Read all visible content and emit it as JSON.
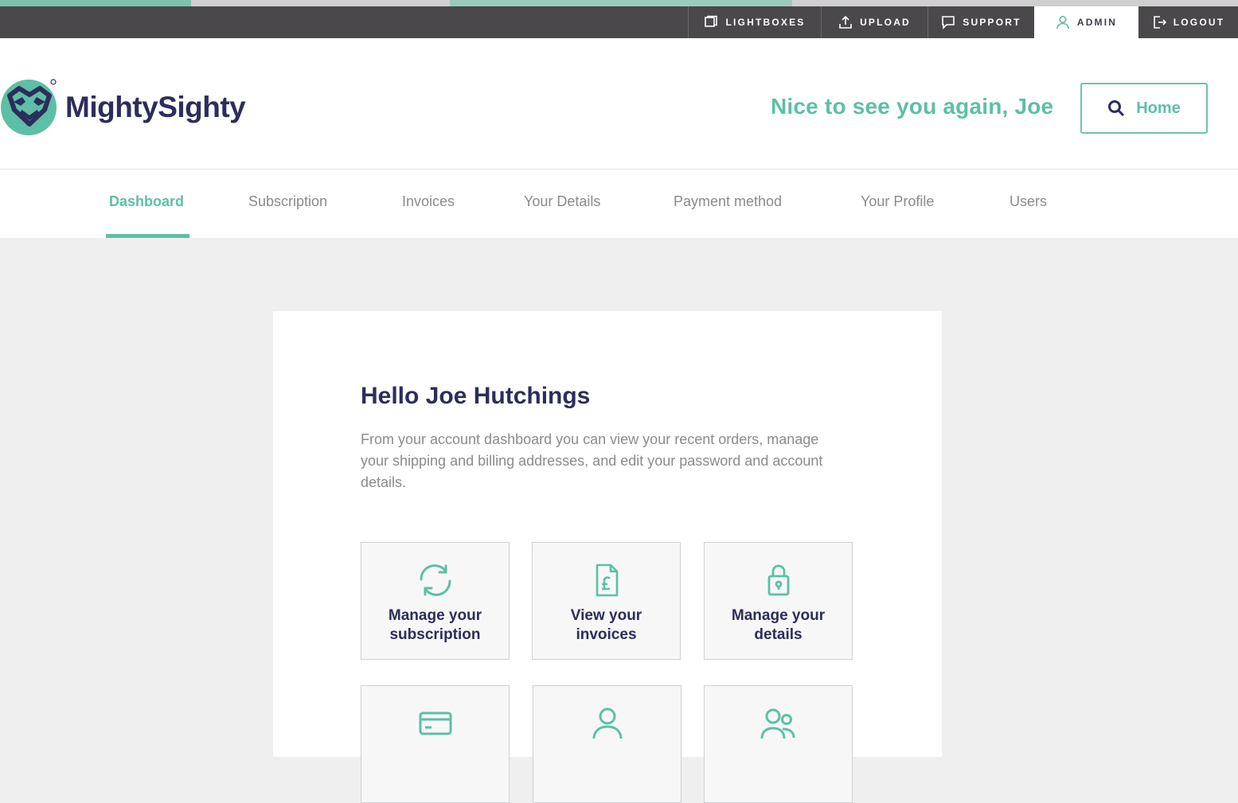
{
  "topbar": {
    "items": [
      {
        "label": "LIGHTBOXES",
        "icon": "lightbox-icon"
      },
      {
        "label": "UPLOAD",
        "icon": "upload-icon"
      },
      {
        "label": "SUPPORT",
        "icon": "support-icon"
      },
      {
        "label": "ADMIN",
        "icon": "user-icon",
        "active": true
      },
      {
        "label": "LOGOUT",
        "icon": "logout-icon"
      }
    ]
  },
  "header": {
    "brand": "MightySighty",
    "greeting": "Nice to see you again, Joe",
    "home_label": "Home"
  },
  "nav": {
    "tabs": [
      {
        "label": "Dashboard",
        "active": true
      },
      {
        "label": "Subscription"
      },
      {
        "label": "Invoices"
      },
      {
        "label": "Your Details"
      },
      {
        "label": "Payment method"
      },
      {
        "label": "Your Profile"
      },
      {
        "label": "Users"
      }
    ]
  },
  "main": {
    "title": "Hello Joe Hutchings",
    "description": "From your account dashboard you can view your recent orders, manage your shipping and billing addresses, and edit your password and account details.",
    "tiles": [
      {
        "label": "Manage your subscription",
        "icon": "refresh-icon"
      },
      {
        "label": "View your invoices",
        "icon": "invoice-icon"
      },
      {
        "label": "Manage your details",
        "icon": "lock-icon"
      },
      {
        "label": "",
        "icon": "card-icon"
      },
      {
        "label": "",
        "icon": "user-icon"
      },
      {
        "label": "",
        "icon": "users-icon"
      }
    ]
  },
  "colors": {
    "accent": "#5dbfa6",
    "navy": "#2d2d5c",
    "utility_bar": "#4a484b"
  }
}
